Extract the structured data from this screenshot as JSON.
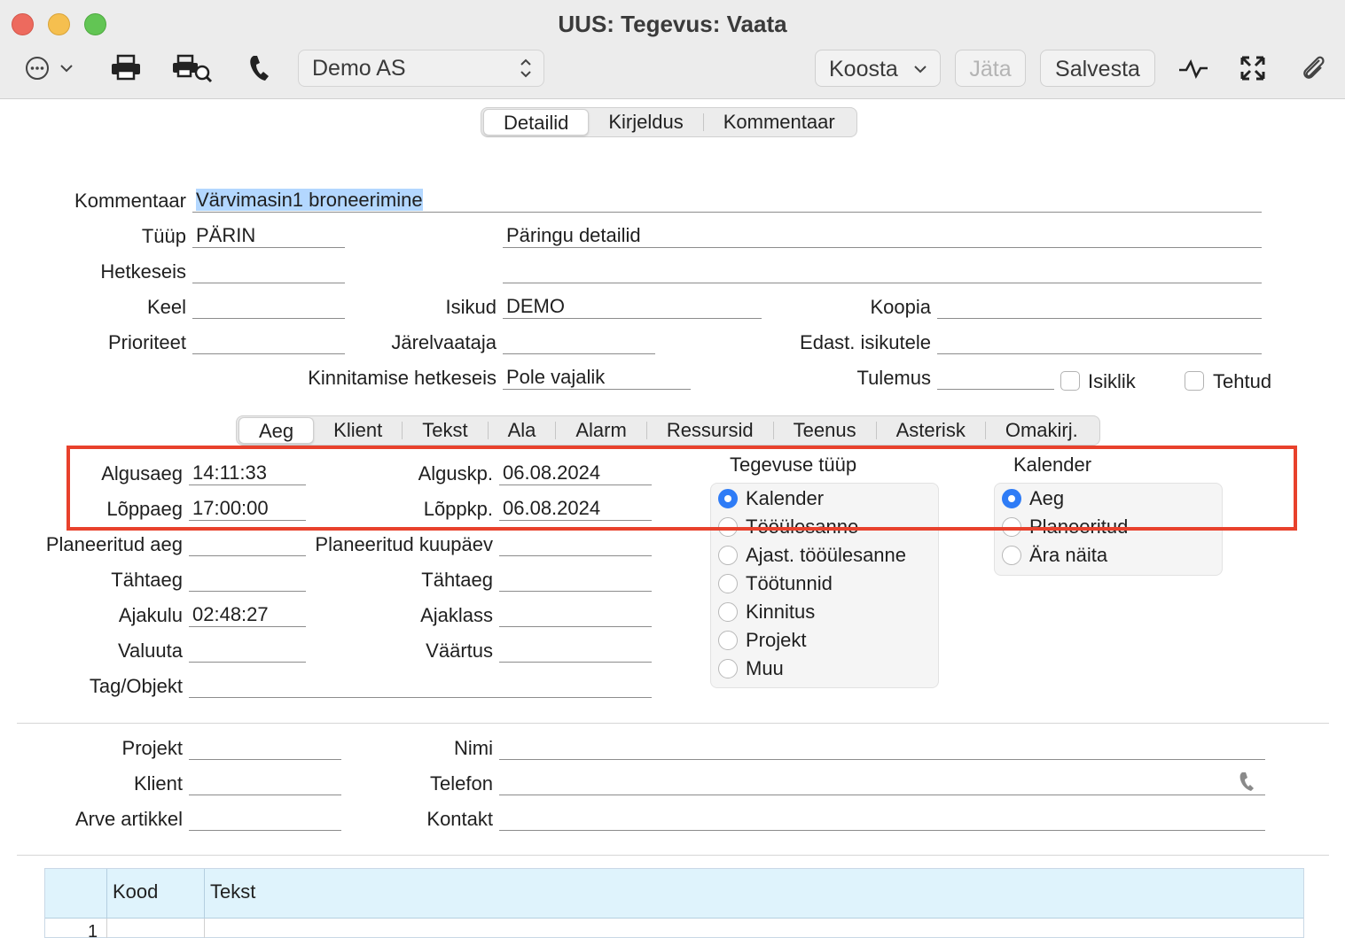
{
  "window": {
    "title": "UUS: Tegevus: Vaata"
  },
  "toolbar": {
    "company": "Demo AS",
    "koosta_label": "Koosta",
    "jata_label": "Jäta",
    "salvesta_label": "Salvesta"
  },
  "tabs_top": [
    "Detailid",
    "Kirjeldus",
    "Kommentaar"
  ],
  "form": {
    "kommentaar_label": "Kommentaar",
    "kommentaar_value": "Värvimasin1 broneerimine",
    "tuup_label": "Tüüp",
    "tuup_value": "PÄRIN",
    "paringu_value": "Päringu detailid",
    "hetkeseis_label": "Hetkeseis",
    "keel_label": "Keel",
    "isikud_label": "Isikud",
    "isikud_value": "DEMO",
    "koopia_label": "Koopia",
    "prioriteet_label": "Prioriteet",
    "jarelvaataja_label": "Järelvaataja",
    "edast_label": "Edast. isikutele",
    "kinnitamise_label": "Kinnitamise hetkeseis",
    "kinnitamise_value": "Pole vajalik",
    "tulemus_label": "Tulemus",
    "isiklik_label": "Isiklik",
    "tehtud_label": "Tehtud"
  },
  "tabs_mid": [
    "Aeg",
    "Klient",
    "Tekst",
    "Ala",
    "Alarm",
    "Ressursid",
    "Teenus",
    "Asterisk",
    "Omakirj."
  ],
  "aeg": {
    "algusaeg_label": "Algusaeg",
    "algusaeg_value": "14:11:33",
    "loppaeg_label": "Lõppaeg",
    "loppaeg_value": "17:00:00",
    "alguskp_label": "Alguskp.",
    "alguskp_value": "06.08.2024",
    "loppkp_label": "Lõppkp.",
    "loppkp_value": "06.08.2024",
    "planeeritud_aeg_label": "Planeeritud aeg",
    "planeeritud_kuupaev_label": "Planeeritud kuupäev",
    "tahtaeg_label": "Tähtaeg",
    "tahtaeg2_label": "Tähtaeg",
    "ajakulu_label": "Ajakulu",
    "ajakulu_value": "02:48:27",
    "ajaklass_label": "Ajaklass",
    "valuuta_label": "Valuuta",
    "vaartus_label": "Väärtus",
    "tag_label": "Tag/Objekt"
  },
  "tegevuse_tuup": {
    "title": "Tegevuse tüüp",
    "options": [
      "Kalender",
      "Tööülesanne",
      "Ajast. tööülesanne",
      "Töötunnid",
      "Kinnitus",
      "Projekt",
      "Muu"
    ],
    "selected": "Kalender"
  },
  "kalender": {
    "title": "Kalender",
    "options": [
      "Aeg",
      "Planeeritud",
      "Ära näita"
    ],
    "selected": "Aeg"
  },
  "project": {
    "projekt_label": "Projekt",
    "klient_label": "Klient",
    "arve_label": "Arve artikkel",
    "nimi_label": "Nimi",
    "telefon_label": "Telefon",
    "kontakt_label": "Kontakt"
  },
  "table": {
    "columns": [
      "Kood",
      "Tekst"
    ],
    "row_number": "1"
  },
  "colors": {
    "accent": "#2f7cf6",
    "highlight": "#e8412c",
    "selection": "#b3d7ff"
  }
}
